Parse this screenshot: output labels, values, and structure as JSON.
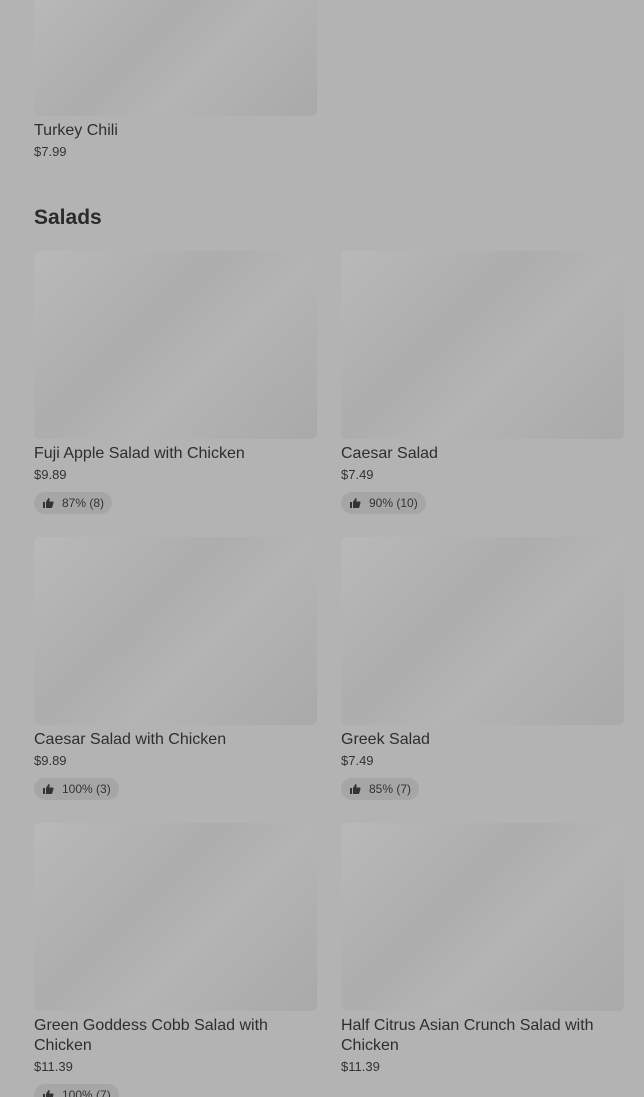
{
  "prev_section": {
    "items": [
      {
        "name": "Turkey Chili",
        "price": "$7.99"
      }
    ]
  },
  "salads": {
    "title": "Salads",
    "items": [
      {
        "name": "Fuji Apple Salad with Chicken",
        "price": "$9.89",
        "rating": "87% (8)"
      },
      {
        "name": "Caesar Salad",
        "price": "$7.49",
        "rating": "90% (10)"
      },
      {
        "name": "Caesar Salad with Chicken",
        "price": "$9.89",
        "rating": "100% (3)"
      },
      {
        "name": "Greek Salad",
        "price": "$7.49",
        "rating": "85% (7)"
      },
      {
        "name": "Green Goddess Cobb Salad with Chicken",
        "price": "$11.39",
        "rating": "100% (7)"
      },
      {
        "name": "Half Citrus Asian Crunch Salad with Chicken",
        "price": "$11.39"
      }
    ]
  },
  "icons": {
    "rating": "thumbs-up-icon"
  }
}
